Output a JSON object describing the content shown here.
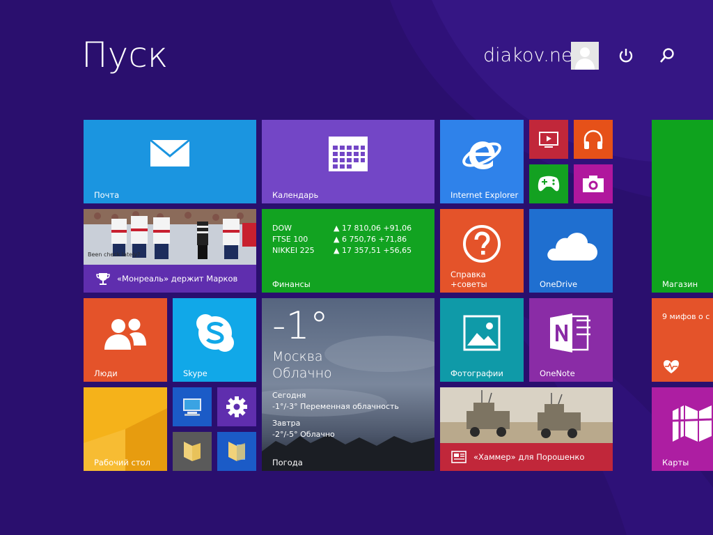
{
  "header": {
    "title": "Пуск",
    "user_name": "diakov.net",
    "icons": [
      "power-icon",
      "search-icon"
    ]
  },
  "tiles": {
    "mail": {
      "label": "Почта",
      "color": "#1b95e0",
      "icon": "mail-icon"
    },
    "calendar": {
      "label": "Календарь",
      "color": "#7346c6",
      "icon": "calendar-icon"
    },
    "ie": {
      "label": "Internet Explorer",
      "color": "#2f82ea",
      "icon": "internet-explorer-icon"
    },
    "video": {
      "color": "#c1273a",
      "icon": "video-icon"
    },
    "music": {
      "color": "#e65119",
      "icon": "headphones-icon"
    },
    "games": {
      "color": "#13a121",
      "icon": "gamepad-icon"
    },
    "camera": {
      "color": "#b0179d",
      "icon": "camera-icon"
    },
    "store": {
      "label": "Магазин",
      "color": "#0fa31e",
      "icon": "store-icon"
    },
    "sports": {
      "caption": "«Монреаль» держит Марков",
      "color": "#5f2eae",
      "icon": "trophy-icon",
      "photo_text": "Been check lately?"
    },
    "finance": {
      "label": "Финансы",
      "color": "#12a321",
      "rows": [
        {
          "name": "DOW",
          "value": "▲ 17 810,06 +91,06"
        },
        {
          "name": "FTSE 100",
          "value": "▲ 6 750,76 +71,86"
        },
        {
          "name": "NIKKEI 225",
          "value": "▲ 17 357,51 +56,65"
        }
      ]
    },
    "help": {
      "label_line1": "Справка",
      "label_line2": "+советы",
      "color": "#e4532a",
      "icon": "help-icon"
    },
    "onedrive": {
      "label": "OneDrive",
      "color": "#1f6fd0",
      "icon": "onedrive-cloud-icon"
    },
    "health": {
      "text": "9 мифов о с",
      "color": "#e4532a",
      "icon": "heart-rate-icon"
    },
    "people": {
      "label": "Люди",
      "color": "#e4532a",
      "icon": "people-icon"
    },
    "skype": {
      "label": "Skype",
      "color": "#11a8e8",
      "icon": "skype-icon"
    },
    "weather": {
      "label": "Погода",
      "temp": "-1°",
      "city": "Москва",
      "condition": "Облачно",
      "today_label": "Сегодня",
      "today_forecast": "-1°/-3° Переменная облачность",
      "tomorrow_label": "Завтра",
      "tomorrow_forecast": "-2°/-5° Облачно"
    },
    "photos": {
      "label": "Фотографии",
      "color": "#0f9aa8",
      "icon": "photo-icon"
    },
    "onenote": {
      "label": "OneNote",
      "color": "#8a2ca6",
      "icon": "onenote-icon"
    },
    "desktop": {
      "label": "Рабочий стол",
      "color": "#f2a811"
    },
    "computer": {
      "color": "#1b5bc7",
      "icon": "computer-icon"
    },
    "settings": {
      "color": "#5f2eae",
      "icon": "gear-icon"
    },
    "folder1": {
      "color": "#5a5a5a",
      "icon": "folder-icon"
    },
    "folder2": {
      "color": "#1b5bc7",
      "icon": "folder-documents-icon"
    },
    "news": {
      "caption": "«Хаммер» для Порошенко",
      "color": "#c1273a",
      "icon": "news-icon"
    },
    "maps": {
      "label": "Карты",
      "color": "#ad1ea2",
      "icon": "map-icon"
    }
  }
}
